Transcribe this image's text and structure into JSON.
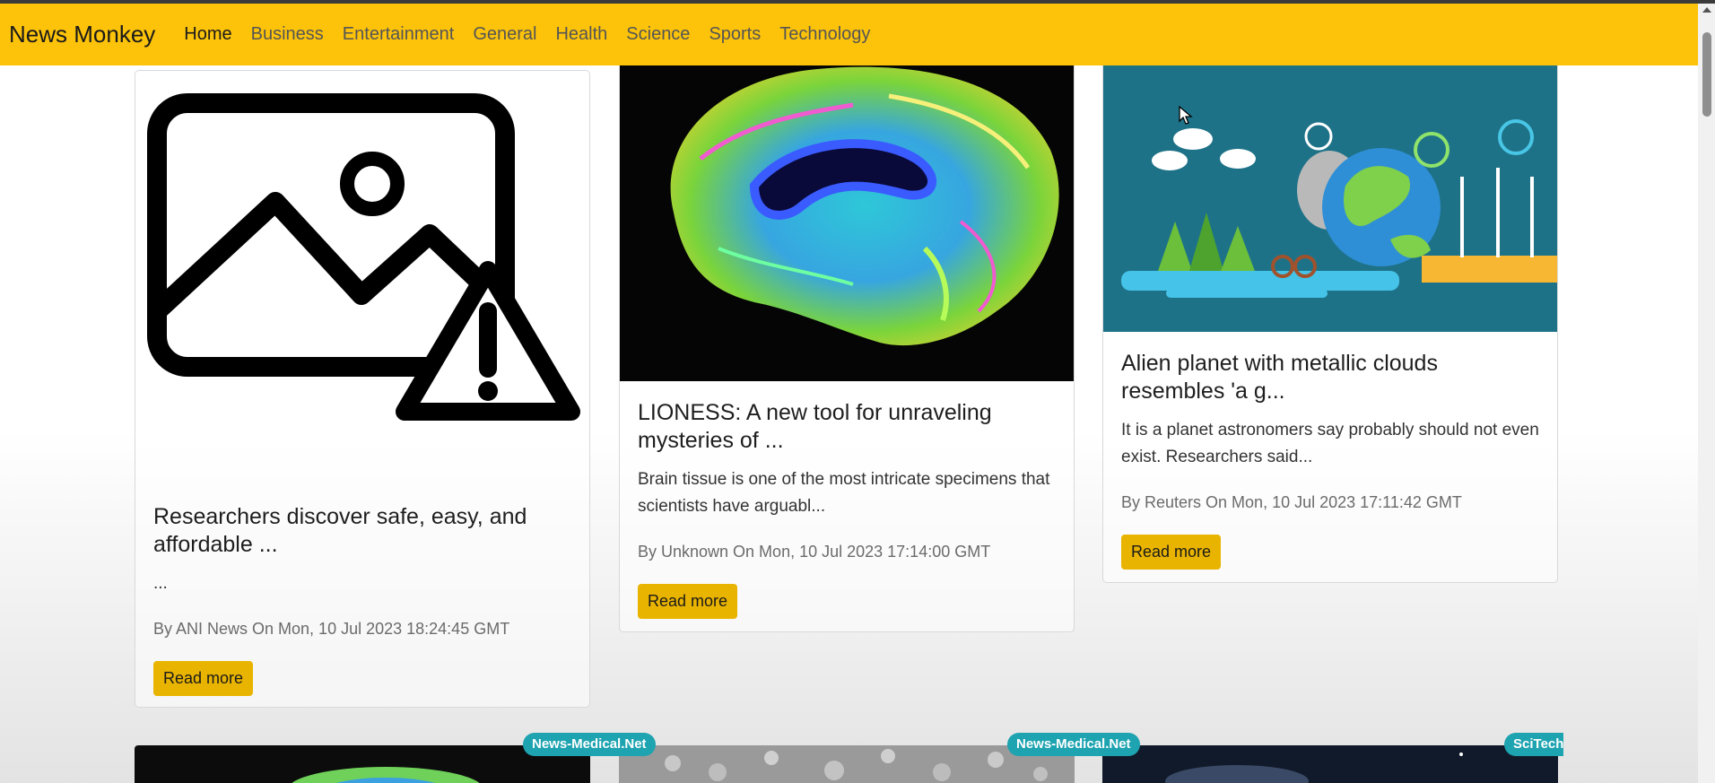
{
  "navbar": {
    "brand": "News Monkey",
    "links": [
      "Home",
      "Business",
      "Entertainment",
      "General",
      "Health",
      "Science",
      "Sports",
      "Technology"
    ],
    "active": "Home",
    "background": "#fcc30a"
  },
  "cards": [
    {
      "title": "Researchers discover safe, easy, and affordable ...",
      "description": "...",
      "meta": "By ANI News On Mon, 10 Jul 2023 18:24:45 GMT",
      "button": "Read more",
      "image": "broken-image-icon"
    },
    {
      "title": "LIONESS: A new tool for unraveling mysteries of ...",
      "description": "Brain tissue is one of the most intricate specimens that scientists have arguabl...",
      "meta": "By Unknown On Mon, 10 Jul 2023 17:14:00 GMT",
      "button": "Read more",
      "image": "brain-scan-image"
    },
    {
      "title": "Alien planet with metallic clouds resembles 'a g...",
      "description": "It is a planet astronomers say probably should not even exist. Researchers said...",
      "meta": "By Reuters On Mon, 10 Jul 2023 17:11:42 GMT",
      "button": "Read more",
      "image": "eco-earth-illustration"
    }
  ],
  "badges": [
    "News-Medical.Net",
    "News-Medical.Net",
    "SciTechD"
  ],
  "colors": {
    "button": "#e9b400",
    "badge": "#1ea3b0"
  }
}
